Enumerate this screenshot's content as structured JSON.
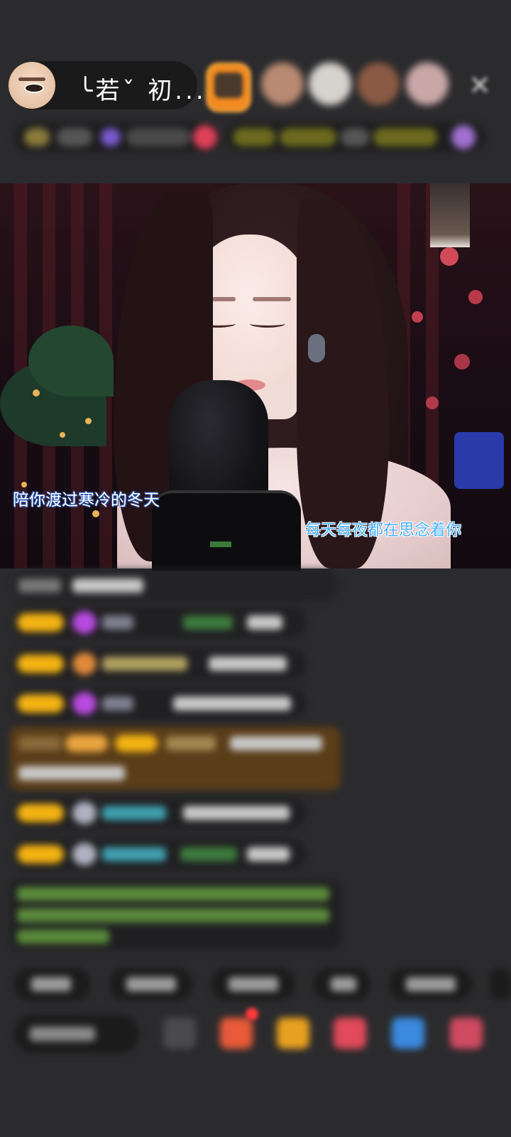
{
  "header": {
    "host_name": "╰若ˇ 初..."
  },
  "video": {
    "subtitle_left": "陪你渡过寒冷的冬天",
    "subtitle_right": "每天每夜都在思念着你"
  },
  "icons": {
    "close": "close-icon"
  },
  "colors": {
    "badge": "#f2b212",
    "gift_bar": "#5a3d19",
    "subtitle_blue": "#4ab0ff"
  }
}
